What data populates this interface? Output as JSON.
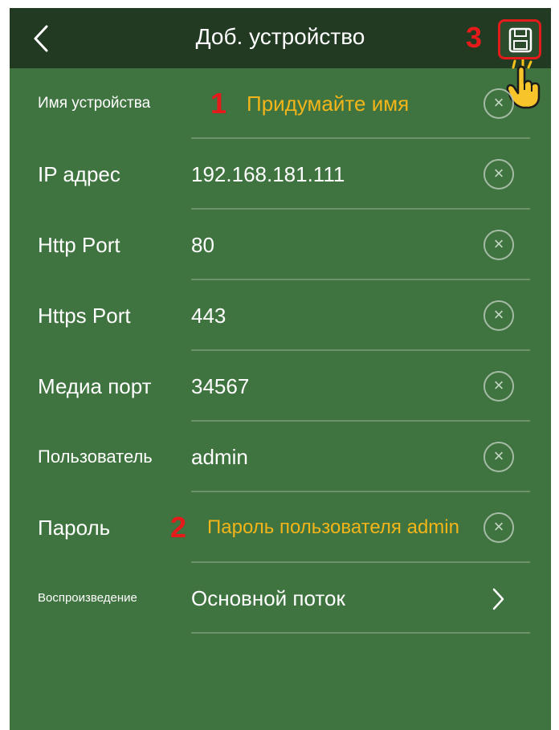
{
  "header": {
    "title": "Доб. устройство",
    "back_icon": "chevron-left-icon",
    "save_icon": "floppy-disk-icon",
    "step_marker": "3"
  },
  "fields": [
    {
      "label": "Имя устройства",
      "value": "Придумайте имя",
      "step": "1",
      "action_icon": "clear-icon"
    },
    {
      "label": "IP адрес",
      "value": "192.168.181.111",
      "action_icon": "clear-icon"
    },
    {
      "label": "Http Port",
      "value": "80",
      "action_icon": "clear-icon"
    },
    {
      "label": "Https Port",
      "value": "443",
      "action_icon": "clear-icon"
    },
    {
      "label": "Медиа порт",
      "value": "34567",
      "action_icon": "clear-icon"
    },
    {
      "label": "Пользователь",
      "value": "admin",
      "action_icon": "clear-icon"
    },
    {
      "label": "Пароль",
      "value": "Пароль пользователя admin",
      "step": "2",
      "action_icon": "clear-icon"
    },
    {
      "label": "Воспроизведение",
      "value": "Основной поток",
      "action_icon": "chevron-right-icon"
    }
  ],
  "clear_glyph": "×",
  "colors": {
    "header_bg": "#223a22",
    "body_bg": "#3f733f",
    "annotation_red": "#e51b1b",
    "hint_yellow": "#f3b51a"
  }
}
